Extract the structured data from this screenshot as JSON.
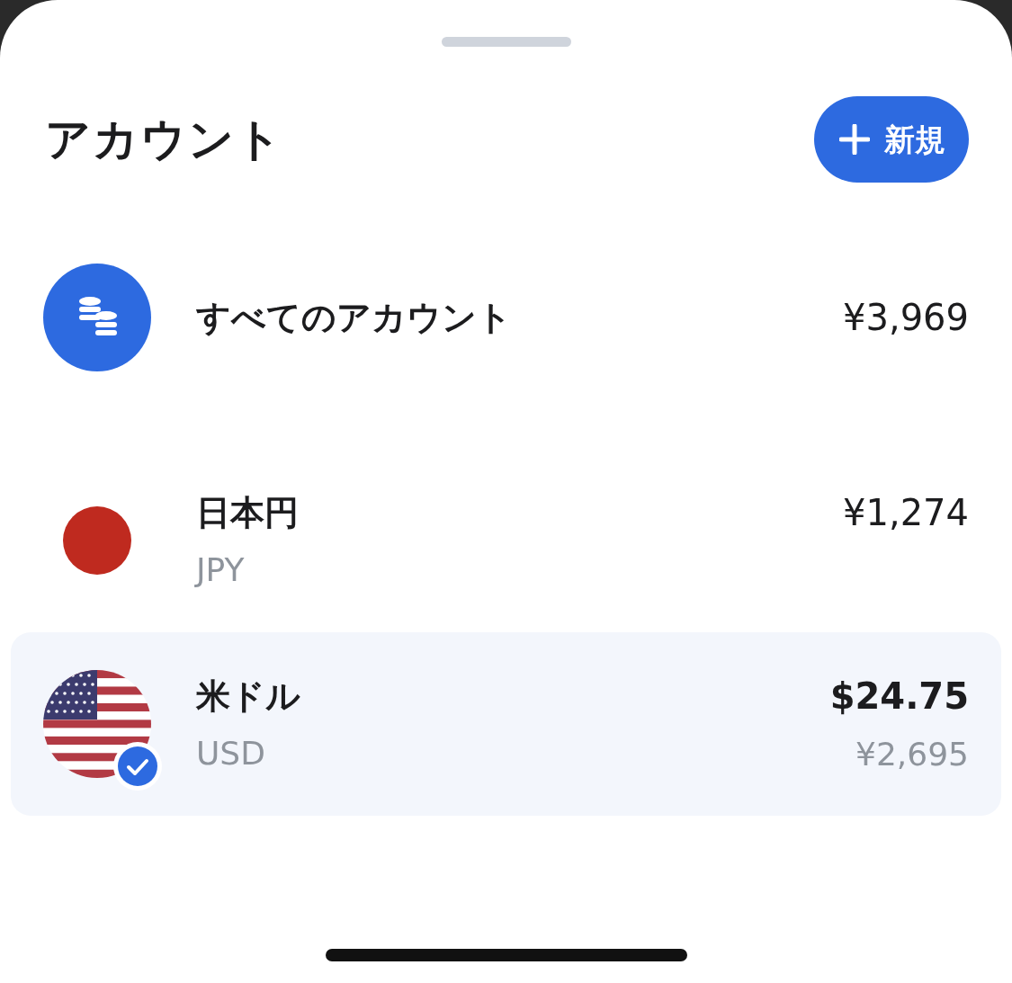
{
  "title": "アカウント",
  "new_button": {
    "label": "新規"
  },
  "accounts": [
    {
      "kind": "all",
      "name": "すべてのアカウント",
      "amount": "¥3,969",
      "selected": false
    },
    {
      "kind": "jp",
      "name": "日本円",
      "code": "JPY",
      "amount": "¥1,274",
      "selected": false
    },
    {
      "kind": "us",
      "name": "米ドル",
      "code": "USD",
      "amount": "$24.75",
      "converted": "¥2,695",
      "selected": true
    }
  ]
}
